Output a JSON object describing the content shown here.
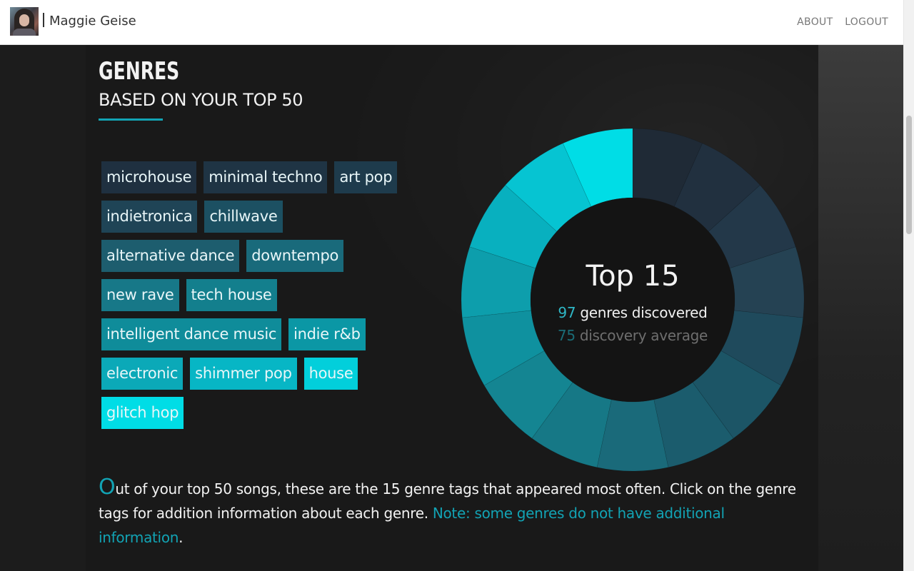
{
  "header": {
    "user_name": "Maggie Geise",
    "nav": [
      "ABOUT",
      "LOGOUT"
    ]
  },
  "section": {
    "title": "GENRES",
    "subtitle": "BASED ON YOUR TOP 50",
    "accent_color": "#12a3b4"
  },
  "genres": [
    [
      "microhouse",
      "minimal techno",
      "art pop"
    ],
    [
      "indietronica",
      "chillwave"
    ],
    [
      "alternative dance",
      "downtempo"
    ],
    [
      "new rave",
      "tech house"
    ],
    [
      "intelligent dance music",
      "indie r&b"
    ],
    [
      "electronic",
      "shimmer pop",
      "house"
    ],
    [
      "glitch hop"
    ]
  ],
  "genre_colors": [
    "#1f2a36",
    "#21303f",
    "#233849",
    "#254253",
    "#1f4a5c",
    "#1c5566",
    "#1b5c6d",
    "#1a6a7a",
    "#167886",
    "#148592",
    "#0f919f",
    "#0d9eac",
    "#08b0bf",
    "#06c4d2",
    "#00dde6"
  ],
  "donut": {
    "center_title": "Top 15",
    "discovered_count": "97",
    "discovered_label": "genres discovered",
    "average_count": "75",
    "average_label": "discovery average"
  },
  "description": {
    "first_letter": "O",
    "text": "ut of your top 50 songs, these are the 15 genre tags that appeared most often. Click on the genre tags for addition information about each genre. ",
    "note": "Note: some genres do not have additional information",
    "end": "."
  }
}
